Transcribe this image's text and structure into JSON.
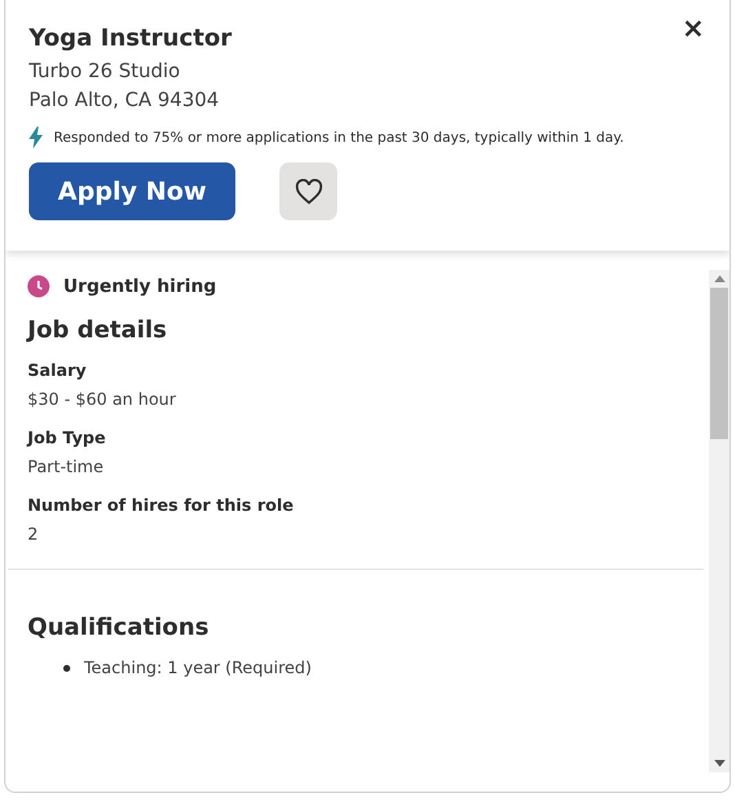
{
  "job": {
    "title": "Yoga Instructor",
    "company": "Turbo 26 Studio",
    "location": "Palo Alto, CA 94304"
  },
  "response_note": "Responded to 75% or more applications in the past 30 days, typically within 1 day.",
  "apply_button": "Apply Now",
  "save_button": {
    "saved": false
  },
  "close_label": "×",
  "urgent_badge": "Urgently hiring",
  "details": {
    "heading": "Job details",
    "fields": [
      {
        "label": "Salary",
        "value": "$30 - $60 an hour"
      },
      {
        "label": "Job Type",
        "value": "Part-time"
      },
      {
        "label": "Number of hires for this role",
        "value": "2"
      }
    ]
  },
  "qualifications": {
    "heading": "Qualifications",
    "items": [
      "Teaching: 1 year (Required)"
    ]
  }
}
